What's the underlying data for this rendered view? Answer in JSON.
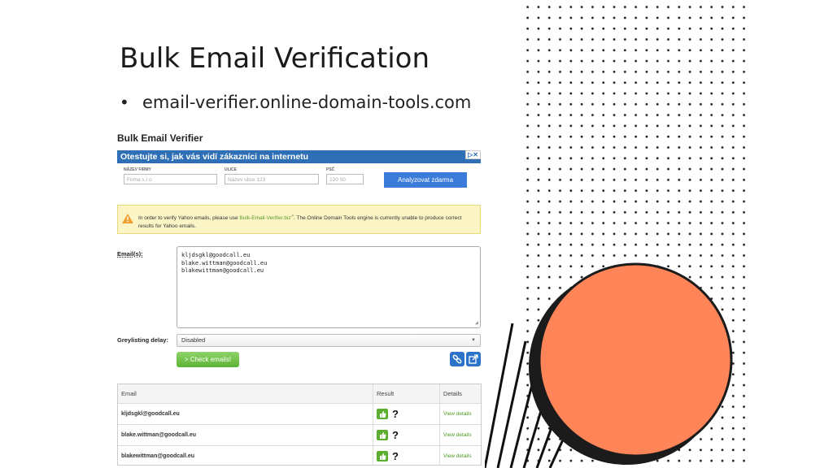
{
  "slide": {
    "title": "Bulk Email Verification",
    "bullet": "email-verifier.online-domain-tools.com"
  },
  "tool": {
    "heading": "Bulk Email Verifier",
    "ad": {
      "banner": "Otestujte si, jak vás vidí zákazníci na internetu",
      "close": "▷✕",
      "fields": [
        {
          "label": "NÁZEV FIRMY",
          "placeholder": "Firma s.r.o"
        },
        {
          "label": "ULICE",
          "placeholder": "Název ulice 123"
        },
        {
          "label": "PSČ",
          "placeholder": "120 00"
        }
      ],
      "button": "Analyzovat zdarma"
    },
    "warning": {
      "text_before": "In order to verify Yahoo emails, please use ",
      "link": "Bulk-Email-Verifier.biz",
      "text_after": ". The Online Domain Tools engine is currently unable to produce correct results for Yahoo emails."
    },
    "emails_label": "Email(s):",
    "emails_value": "kljdsgkl@goodcall.eu\nblake.wittman@goodcall.eu\nblakewittman@goodcall.eu",
    "greylisting_label": "Greylisting delay:",
    "greylisting_value": "Disabled",
    "check_button": "> Check emails!",
    "results": {
      "columns": [
        "Email",
        "Result",
        "Details"
      ],
      "rows": [
        {
          "email": "kljdsgkl@goodcall.eu",
          "result": "?",
          "details": "View details"
        },
        {
          "email": "blake.wittman@goodcall.eu",
          "result": "?",
          "details": "View details"
        },
        {
          "email": "blakewittman@goodcall.eu",
          "result": "?",
          "details": "View details"
        }
      ]
    }
  },
  "colors": {
    "accent_circle": "#ff8559",
    "banner_blue": "#2e6fb5",
    "check_green": "#5cb334",
    "link_green": "#4a9a1e"
  }
}
